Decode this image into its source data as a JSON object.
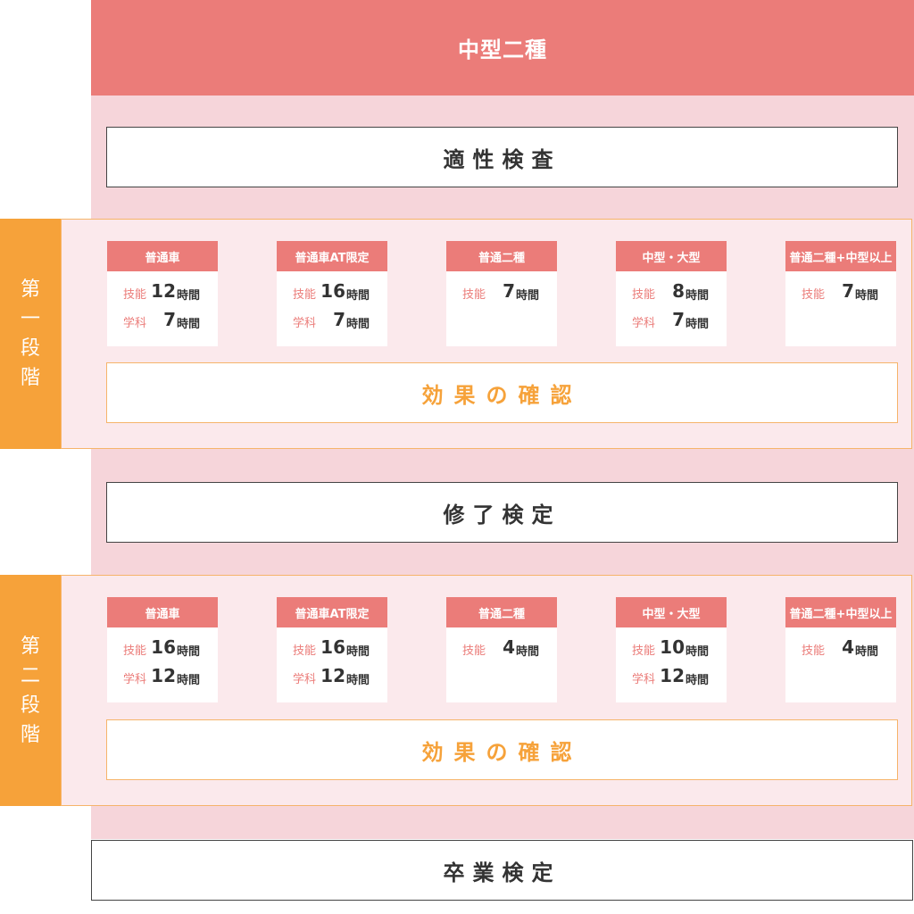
{
  "header": {
    "title": "中型二種"
  },
  "steps": {
    "aptitude": "適性検査",
    "completion": "修了検定",
    "graduation": "卒業検定"
  },
  "stage1": {
    "label": [
      "第",
      "一",
      "段",
      "階"
    ],
    "confirm": "効果の確認",
    "cards": [
      {
        "title": "普通車",
        "rows": [
          {
            "kind": "技能",
            "num": "12",
            "unit": "時間"
          },
          {
            "kind": "学科",
            "num": "7",
            "unit": "時間"
          }
        ]
      },
      {
        "title": "普通車AT限定",
        "rows": [
          {
            "kind": "技能",
            "num": "16",
            "unit": "時間"
          },
          {
            "kind": "学科",
            "num": "7",
            "unit": "時間"
          }
        ]
      },
      {
        "title": "普通二種",
        "rows": [
          {
            "kind": "技能",
            "num": "7",
            "unit": "時間"
          }
        ]
      },
      {
        "title": "中型・大型",
        "rows": [
          {
            "kind": "技能",
            "num": "8",
            "unit": "時間"
          },
          {
            "kind": "学科",
            "num": "7",
            "unit": "時間"
          }
        ]
      },
      {
        "title": "普通二種+中型以上",
        "rows": [
          {
            "kind": "技能",
            "num": "7",
            "unit": "時間"
          }
        ]
      }
    ]
  },
  "stage2": {
    "label": [
      "第",
      "二",
      "段",
      "階"
    ],
    "confirm": "効果の確認",
    "cards": [
      {
        "title": "普通車",
        "rows": [
          {
            "kind": "技能",
            "num": "16",
            "unit": "時間"
          },
          {
            "kind": "学科",
            "num": "12",
            "unit": "時間"
          }
        ]
      },
      {
        "title": "普通車AT限定",
        "rows": [
          {
            "kind": "技能",
            "num": "16",
            "unit": "時間"
          },
          {
            "kind": "学科",
            "num": "12",
            "unit": "時間"
          }
        ]
      },
      {
        "title": "普通二種",
        "rows": [
          {
            "kind": "技能",
            "num": "4",
            "unit": "時間"
          }
        ]
      },
      {
        "title": "中型・大型",
        "rows": [
          {
            "kind": "技能",
            "num": "10",
            "unit": "時間"
          },
          {
            "kind": "学科",
            "num": "12",
            "unit": "時間"
          }
        ]
      },
      {
        "title": "普通二種+中型以上",
        "rows": [
          {
            "kind": "技能",
            "num": "4",
            "unit": "時間"
          }
        ]
      }
    ]
  }
}
